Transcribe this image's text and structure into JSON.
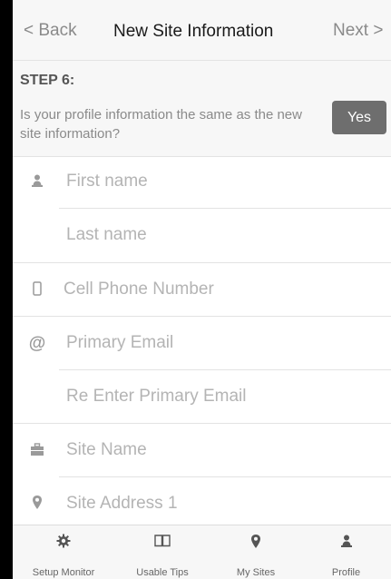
{
  "nav": {
    "back_label": "< Back",
    "title": "New Site Information",
    "next_label": "Next >"
  },
  "step": {
    "label": "STEP 6:",
    "question": "Is your profile information the same as the new site information?",
    "yes_label": "Yes"
  },
  "form": {
    "first_name_placeholder": "First name",
    "last_name_placeholder": "Last name",
    "cell_phone_placeholder": "Cell Phone Number",
    "primary_email_placeholder": "Primary Email",
    "reenter_email_placeholder": "Re Enter Primary Email",
    "site_name_placeholder": "Site Name",
    "site_address_placeholder": "Site Address 1",
    "icons": [
      "user-icon",
      "phone-icon",
      "at-icon",
      "briefcase-icon",
      "map-pin-icon"
    ]
  },
  "tabbar": {
    "tabs": [
      {
        "label": "Setup Monitor",
        "icon": "gear-icon"
      },
      {
        "label": "Usable Tips",
        "icon": "book-icon"
      },
      {
        "label": "My Sites",
        "icon": "map-pin-icon"
      },
      {
        "label": "Profile",
        "icon": "user-icon"
      }
    ]
  }
}
